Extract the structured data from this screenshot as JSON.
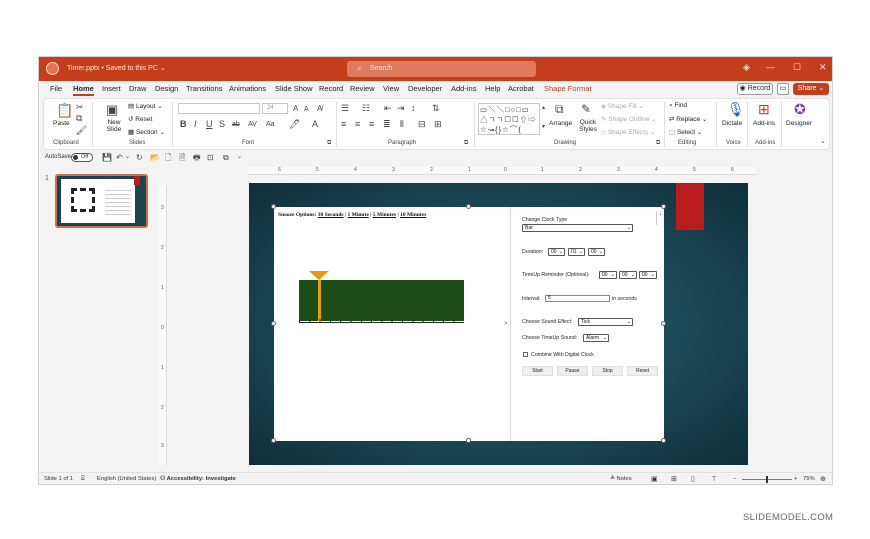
{
  "titlebar": {
    "doc_title": "Timer.pptx • Saved to this PC ⌄",
    "search_placeholder": "Search",
    "btn_minimize": "—",
    "btn_maximize": "☐",
    "btn_close": "✕"
  },
  "menu": {
    "tabs": [
      "File",
      "Home",
      "Insert",
      "Draw",
      "Design",
      "Transitions",
      "Animations",
      "Slide Show",
      "Record",
      "Review",
      "View",
      "Developer",
      "Add-ins",
      "Help",
      "Acrobat",
      "Shape Format"
    ],
    "active_tab": "Home",
    "record_label": "Record",
    "share_label": "Share"
  },
  "ribbon": {
    "clipboard": {
      "paste": "Paste",
      "group": "Clipboard"
    },
    "slides": {
      "new_slide": "New Slide",
      "layout": "Layout",
      "reset": "Reset",
      "section": "Section",
      "group": "Slides"
    },
    "font": {
      "size": "24",
      "group": "Font"
    },
    "paragraph": {
      "group": "Paragraph"
    },
    "drawing": {
      "arrange": "Arrange",
      "quick_styles": "Quick Styles",
      "shape_fill": "Shape Fill",
      "shape_outline": "Shape Outline",
      "shape_effects": "Shape Effects",
      "group": "Drawing"
    },
    "editing": {
      "find": "Find",
      "replace": "Replace",
      "select": "Select",
      "group": "Editing"
    },
    "voice": {
      "dictate": "Dictate",
      "group": "Voice"
    },
    "addins": {
      "addins": "Add-ins",
      "group": "Add-ins"
    },
    "designer": {
      "designer": "Designer"
    }
  },
  "qat": {
    "autosave_label": "AutoSave",
    "autosave_state": "Off"
  },
  "slide_pane": {
    "slide_number": "1"
  },
  "ruler": {
    "h_ticks": [
      "6",
      "5",
      "4",
      "3",
      "2",
      "1",
      "0",
      "1",
      "2",
      "3",
      "4",
      "5",
      "6"
    ],
    "v_ticks": [
      "3",
      "2",
      "1",
      "0",
      "1",
      "2",
      "3"
    ]
  },
  "slide": {
    "snooze_prefix": "Snooze Options:",
    "snooze_options": [
      "30 Seconds",
      "1 Minute",
      "5 Minutes",
      "10 Minutes"
    ],
    "snooze_sep": " | ",
    "change_clock_type_label": "Change Clock Type",
    "clock_type_value": "Bar",
    "duration_label": "Duration:",
    "duration_values": [
      "00",
      "01",
      "00"
    ],
    "timeup_reminder_label": "TimeUp Reminder (Optional):",
    "timeup_reminder_values": [
      "00",
      "00",
      "00"
    ],
    "interval_label": "Interval:",
    "interval_value": "5",
    "interval_unit": "in seconds",
    "sound_effect_label": "Choose Sound Effect:",
    "sound_effect_value": "Tick",
    "timeup_sound_label": "Choose TimeUp Sound:",
    "timeup_sound_value": "Alarm",
    "digital_clock_label": "Combine With Digital Clock",
    "buttons": {
      "start": "Start",
      "pause": "Pause",
      "stop": "Stop",
      "reset": "Reset"
    },
    "split_arrow": ">",
    "collapse_arrow": "‹"
  },
  "statusbar": {
    "slide_of": "Slide 1 of 1",
    "language": "English (United States)",
    "accessibility": "Accessibility: Investigate",
    "notes": "Notes",
    "zoom": "75%",
    "zoom_minus": "−",
    "zoom_plus": "+"
  },
  "watermark": "SLIDEMODEL.COM",
  "colors": {
    "accent": "#c43e1c",
    "slide_bg": "#1a4553",
    "timer_bar": "#1c4d17",
    "timer_pin": "#e39a18",
    "red_tag": "#b91c1c"
  }
}
